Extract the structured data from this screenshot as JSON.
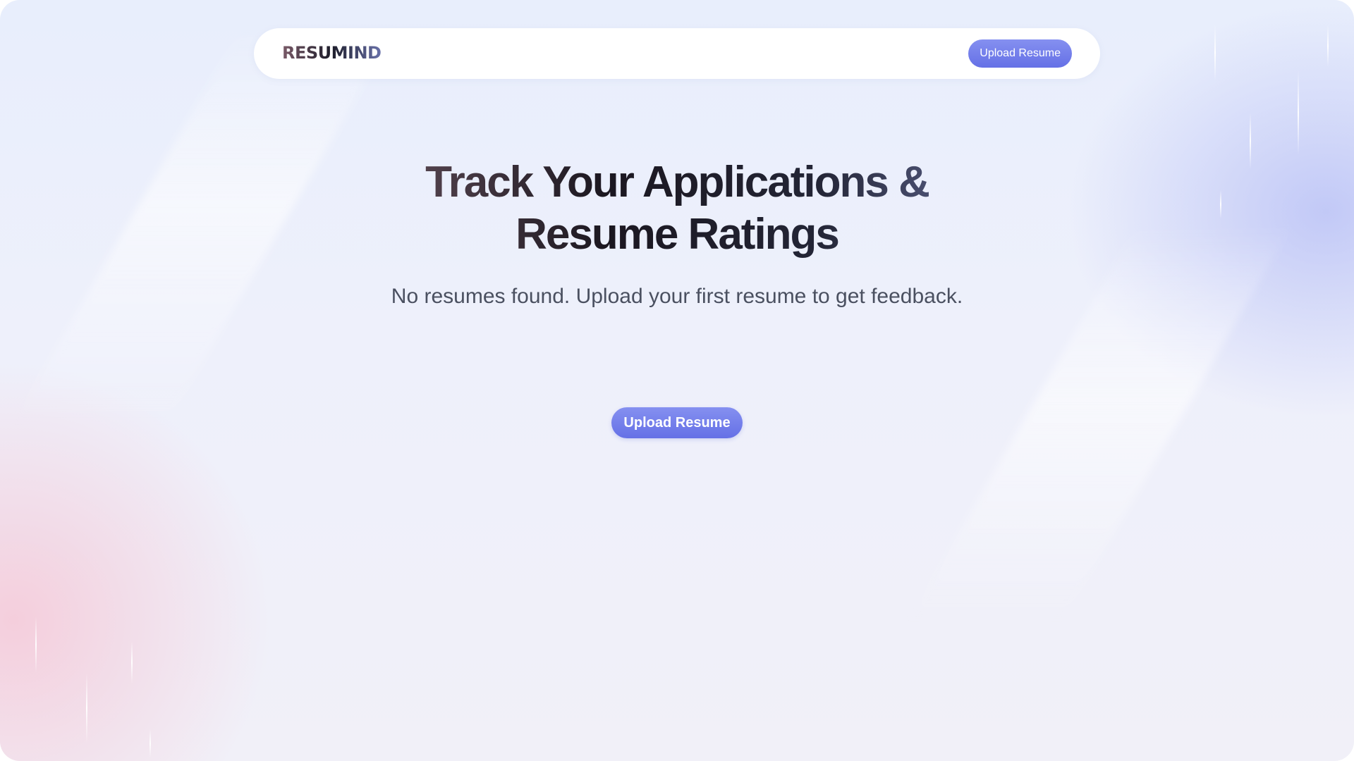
{
  "navbar": {
    "logo": "RESUMIND",
    "upload_label": "Upload Resume"
  },
  "hero": {
    "title_line1": "Track Your Applications &",
    "title_line2": "Resume Ratings",
    "subtitle": "No resumes found. Upload your first resume to get feedback.",
    "cta_label": "Upload Resume"
  },
  "colors": {
    "accent": "#6C74E8",
    "background": "#ECEFFB",
    "subtitle_text": "#4A5060"
  }
}
